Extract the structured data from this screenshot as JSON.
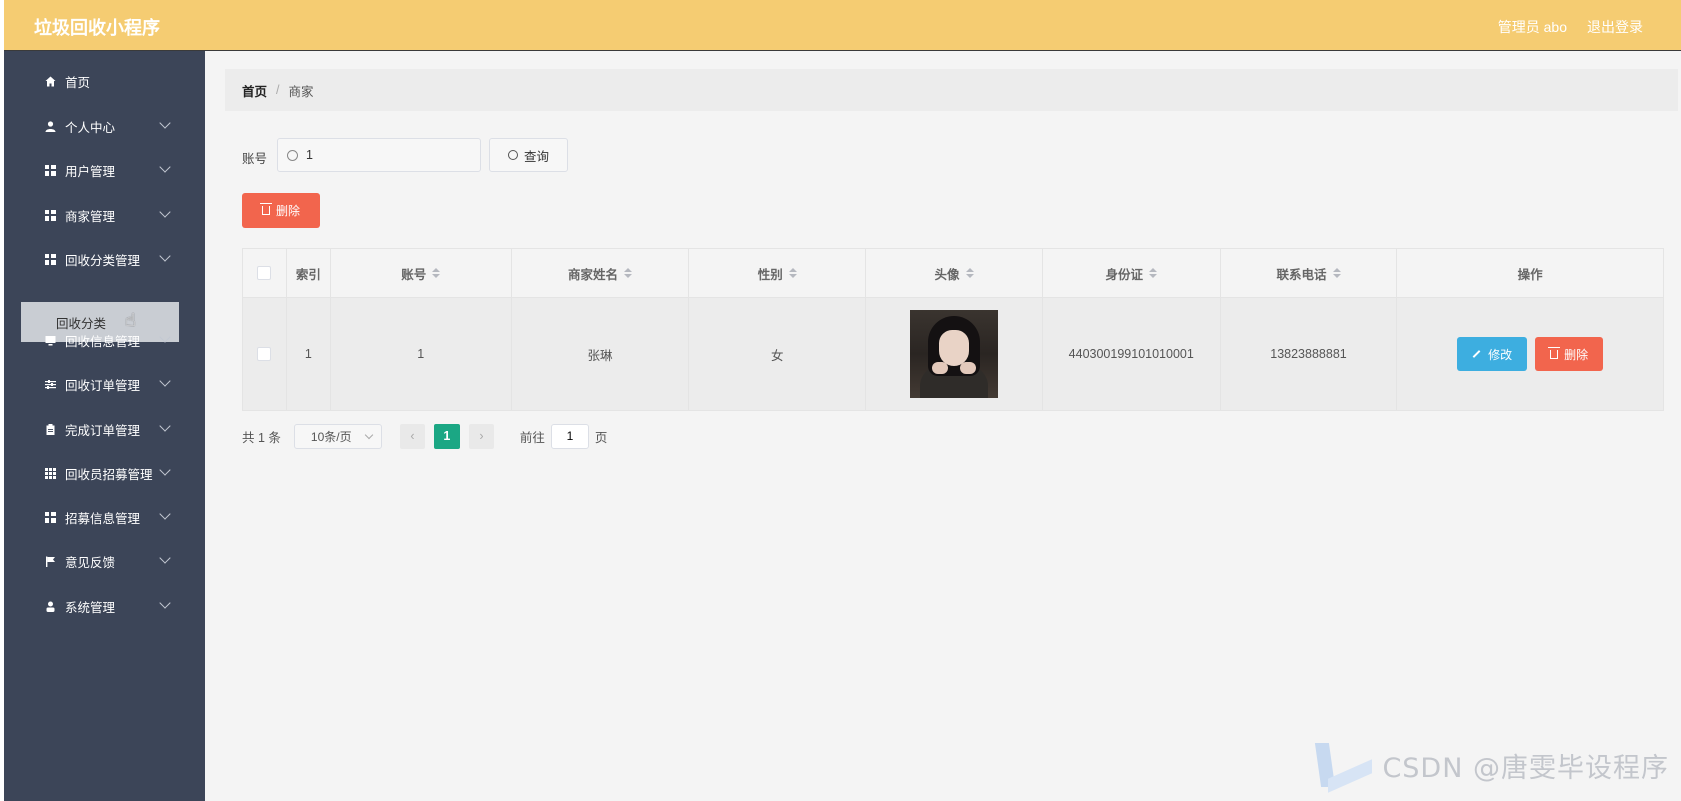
{
  "header": {
    "app_title": "垃圾回收小程序",
    "user": "管理员 abo",
    "logout": "退出登录",
    "bg_color": "#f5cc72"
  },
  "sidebar": {
    "bg_color": "#3c4558",
    "items": [
      {
        "label": "首页",
        "icon": "home-icon",
        "has_children": false
      },
      {
        "label": "个人中心",
        "icon": "user-icon",
        "has_children": true
      },
      {
        "label": "用户管理",
        "icon": "grid-icon",
        "has_children": true
      },
      {
        "label": "商家管理",
        "icon": "grid-icon",
        "has_children": true
      },
      {
        "label": "回收分类管理",
        "icon": "grid-icon",
        "has_children": true,
        "expanded": true
      },
      {
        "label": "回收信息管理",
        "icon": "monitor-icon",
        "has_children": true
      },
      {
        "label": "回收订单管理",
        "icon": "sliders-icon",
        "has_children": true
      },
      {
        "label": "完成订单管理",
        "icon": "clipboard-icon",
        "has_children": true
      },
      {
        "label": "回收员招募管理",
        "icon": "grid9-icon",
        "has_children": true
      },
      {
        "label": "招募信息管理",
        "icon": "grid-icon",
        "has_children": true
      },
      {
        "label": "意见反馈",
        "icon": "flag-icon",
        "has_children": true
      },
      {
        "label": "系统管理",
        "icon": "person-icon",
        "has_children": true
      }
    ],
    "submenu_active": "回收分类"
  },
  "breadcrumb": {
    "home": "首页",
    "separator": "/",
    "current": "商家"
  },
  "search": {
    "label": "账号",
    "value": "1",
    "button": "查询"
  },
  "toolbar": {
    "delete": "删除"
  },
  "table": {
    "columns": [
      "",
      "索引",
      "账号",
      "商家姓名",
      "性别",
      "头像",
      "身份证",
      "联系电话",
      "操作"
    ],
    "rows": [
      {
        "index": "1",
        "account": "1",
        "name": "张琳",
        "gender": "女",
        "avatar": "avatar-photo",
        "id_card": "440300199101010001",
        "phone": "13823888881",
        "edit": "修改",
        "delete": "删除"
      }
    ]
  },
  "pagination": {
    "total": "共 1 条",
    "page_size": "10条/页",
    "current_page": "1",
    "goto_label": "前往",
    "goto_value": "1",
    "page_suffix": "页"
  },
  "watermark": "CSDN @唐雯毕设程序",
  "colors": {
    "danger": "#f2654d",
    "primary": "#3daee0",
    "active_page": "#1ba784"
  }
}
